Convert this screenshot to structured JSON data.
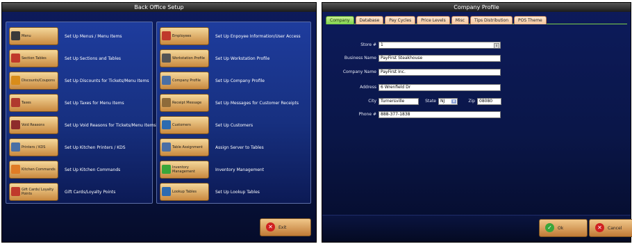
{
  "back_office": {
    "title": "Back Office Setup",
    "left_items": [
      {
        "label": "Menu",
        "desc": "Set Up Menus / Menu Items",
        "icon": "menu-plate-icon",
        "color": "#3a3a3a"
      },
      {
        "label": "Section Tables",
        "desc": "Set Up Sections and Tables",
        "icon": "section-tables-icon",
        "color": "#c0392b"
      },
      {
        "label": "Discounts/Coupons",
        "desc": "Set Up Discounts for Tickets/Menu Items",
        "icon": "discounts-icon",
        "color": "#d98c1a"
      },
      {
        "label": "Taxes",
        "desc": "Set Up Taxes for Menu Items",
        "icon": "taxes-icon",
        "color": "#b03a2e"
      },
      {
        "label": "Void Reasons",
        "desc": "Set Up Void Reasons for Tickets/Menu Items",
        "icon": "void-reasons-icon",
        "color": "#8e2b2b"
      },
      {
        "label": "Printers / KDS",
        "desc": "Set Up Kitchen Printers / KDS",
        "icon": "printer-icon",
        "color": "#4a6fa5"
      },
      {
        "label": "Kitchen Commands",
        "desc": "Set Up Kitchen Commands",
        "icon": "kitchen-commands-icon",
        "color": "#e07b25"
      },
      {
        "label": "Gift Cards/ Loyalty Points",
        "desc": "Gift Cards/Loyalty Points",
        "icon": "gift-card-icon",
        "color": "#c0392b"
      }
    ],
    "right_items": [
      {
        "label": "Employees",
        "desc": "Set Up Enpoyee Information/User Access",
        "icon": "employees-icon",
        "color": "#c0392b"
      },
      {
        "label": "Workstation Profile",
        "desc": "Set Up Workstation Profile",
        "icon": "workstation-icon",
        "color": "#555555"
      },
      {
        "label": "Company Profile",
        "desc": "Set Up Company Profile",
        "icon": "company-profile-icon",
        "color": "#4a6fa5"
      },
      {
        "label": "Receipt Message",
        "desc": "Set Up Messages for Customer Receipts",
        "icon": "receipt-icon",
        "color": "#8e6b3a"
      },
      {
        "label": "Customers",
        "desc": "Set Up Customers",
        "icon": "customers-icon",
        "color": "#2d6bb0"
      },
      {
        "label": "Table Assignment",
        "desc": "Assign Server to Tables",
        "icon": "table-assignment-icon",
        "color": "#4a6fa5"
      },
      {
        "label": "Inventory Management",
        "desc": "Inventory Management",
        "icon": "inventory-icon",
        "color": "#3aa63a"
      },
      {
        "label": "Lookup Tables",
        "desc": "Set Up Lookup Tables",
        "icon": "lookup-tables-icon",
        "color": "#2d6bb0"
      }
    ],
    "exit_label": "Exit"
  },
  "company_profile": {
    "title": "Company Profile",
    "tabs": [
      "Company",
      "Database",
      "Pay Cycles",
      "Price Levels",
      "Misc",
      "Tips Distribution",
      "POS Theme"
    ],
    "active_tab": "Company",
    "fields": {
      "store_label": "Store #",
      "store_value": "1",
      "business_label": "Business Name",
      "business_value": "PayFirst Steakhouse",
      "company_label": "Company Name",
      "company_value": "PayFirst Inc.",
      "address_label": "Address",
      "address_value": "6 Wrenfield Dr",
      "city_label": "City",
      "city_value": "Turnersville",
      "state_label": "State",
      "state_value": "NJ",
      "zip_label": "Zip",
      "zip_value": "08080",
      "phone_label": "Phone #",
      "phone_value": "888-377-1838"
    },
    "ok_label": "Ok",
    "cancel_label": "Cancel"
  },
  "colors": {
    "accent_green": "#7ed24a",
    "button_gold": "#e0a860",
    "bg_navy": "#0d1b5c",
    "exit_red": "#d02020"
  }
}
